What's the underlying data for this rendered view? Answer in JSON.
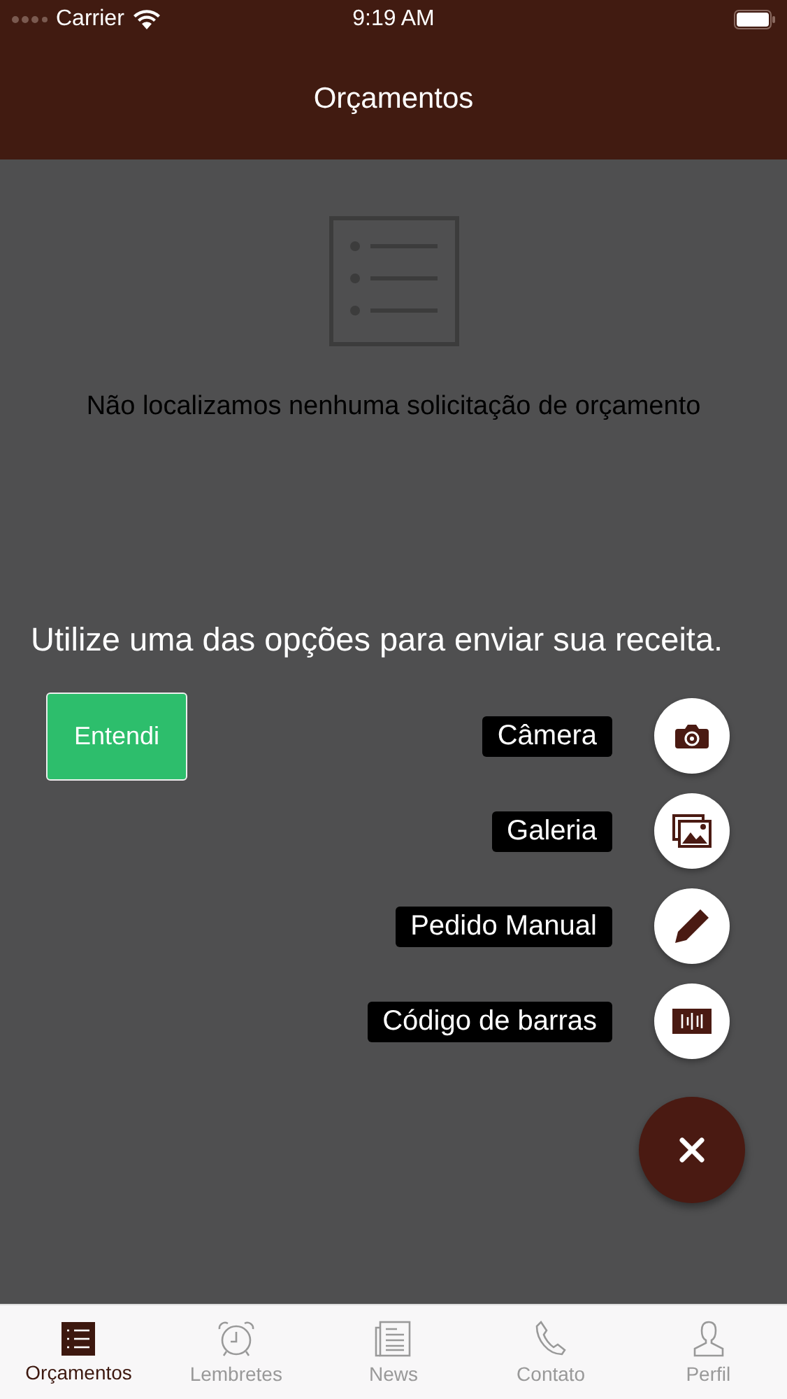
{
  "status_bar": {
    "carrier": "Carrier",
    "time": "9:19 AM"
  },
  "nav": {
    "title": "Orçamentos"
  },
  "empty_state": {
    "message": "Não localizamos nenhuma solicitação de orçamento"
  },
  "tip": {
    "text": "Utilize uma das opções para enviar sua receita.",
    "button": "Entendi"
  },
  "actions": [
    {
      "label": "Câmera",
      "kind": "camera"
    },
    {
      "label": "Galeria",
      "kind": "gallery"
    },
    {
      "label": "Pedido Manual",
      "kind": "pencil"
    },
    {
      "label": "Código de barras",
      "kind": "barcode"
    }
  ],
  "tabs": [
    {
      "label": "Orçamentos",
      "kind": "list",
      "selected": true
    },
    {
      "label": "Lembretes",
      "kind": "clock",
      "selected": false
    },
    {
      "label": "News",
      "kind": "news",
      "selected": false
    },
    {
      "label": "Contato",
      "kind": "phone",
      "selected": false
    },
    {
      "label": "Perfil",
      "kind": "person",
      "selected": false
    }
  ]
}
